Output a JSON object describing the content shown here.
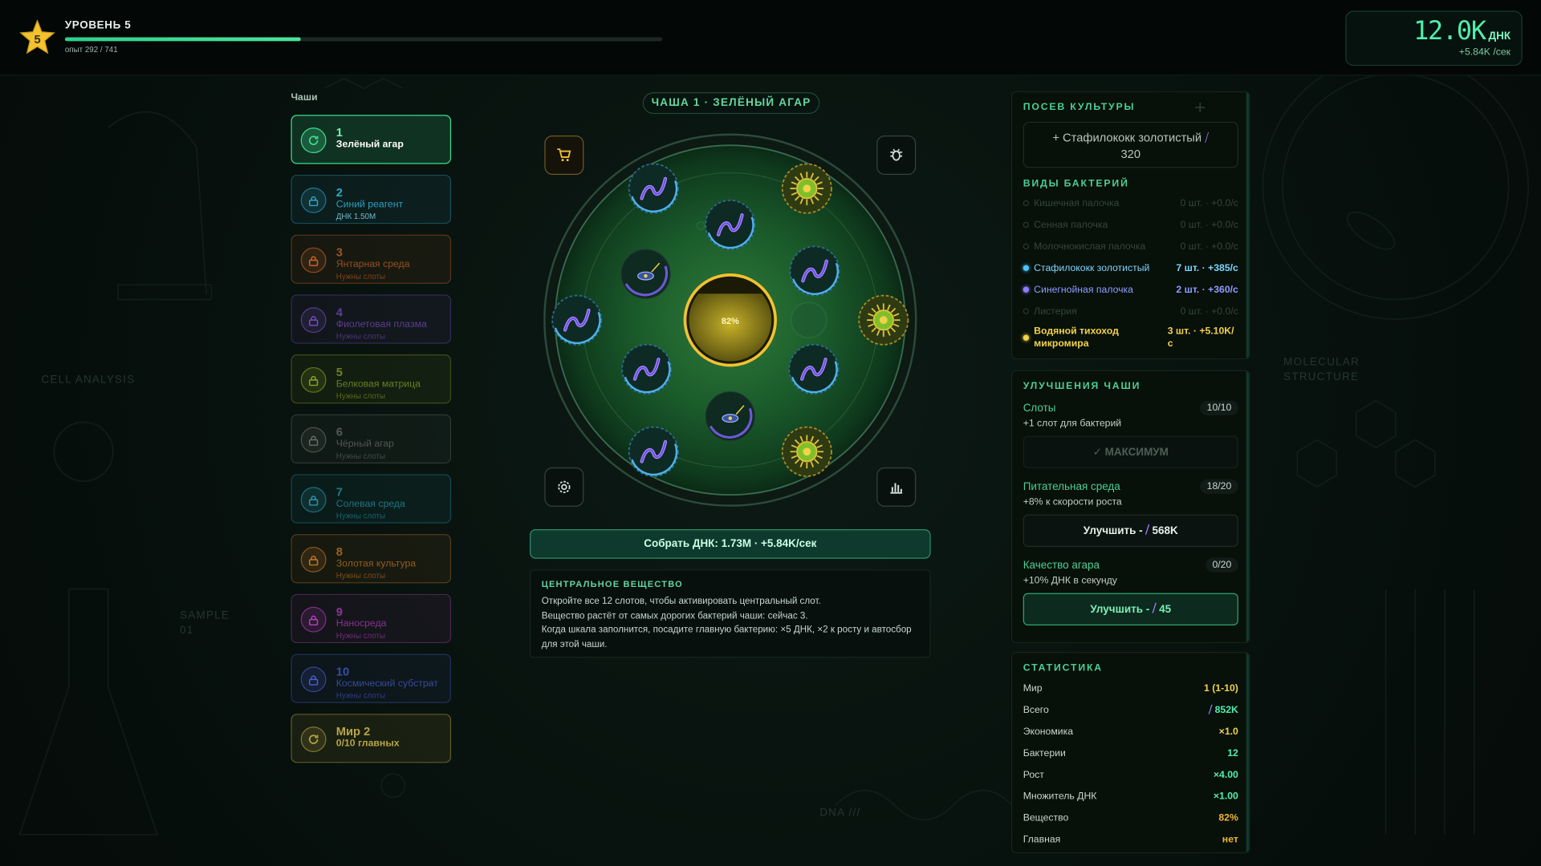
{
  "header": {
    "level_title": "УРОВЕНЬ 5",
    "level_number": "5",
    "xp_text": "опыт 292 / 741",
    "xp_progress": 0.394
  },
  "currency": {
    "value": "12.0K",
    "unit": "ДНК",
    "rate": "+5.84K /сек"
  },
  "sidebar": {
    "title": "Чаши",
    "dishes": [
      {
        "num": "1",
        "name": "Зелёный агар",
        "sub": "",
        "state": "active",
        "color": "#3ddc8f"
      },
      {
        "num": "2",
        "name": "Синий реагент",
        "sub": "ДНК 1.50M",
        "state": "unlockable",
        "color": "#2fa6c8"
      },
      {
        "num": "3",
        "name": "Янтарная среда",
        "sub": "Нужны слоты",
        "state": "locked",
        "color": "#c9662c"
      },
      {
        "num": "4",
        "name": "Фиолетовая плазма",
        "sub": "Нужны слоты",
        "state": "locked",
        "color": "#7a4ec0"
      },
      {
        "num": "5",
        "name": "Белковая матрица",
        "sub": "Нужны слоты",
        "state": "locked",
        "color": "#8aa62a"
      },
      {
        "num": "6",
        "name": "Чёрный агар",
        "sub": "Нужны слоты",
        "state": "locked",
        "color": "#6a6f6d"
      },
      {
        "num": "7",
        "name": "Солевая среда",
        "sub": "Нужны слоты",
        "state": "locked",
        "color": "#2b97ad"
      },
      {
        "num": "8",
        "name": "Золотая культура",
        "sub": "Нужны слоты",
        "state": "locked",
        "color": "#c7782a"
      },
      {
        "num": "9",
        "name": "Наносреда",
        "sub": "Нужны слоты",
        "state": "locked",
        "color": "#b53fbf"
      },
      {
        "num": "10",
        "name": "Космический субстрат",
        "sub": "Нужны слоты",
        "state": "locked",
        "color": "#4a5fd0"
      }
    ],
    "world_card": {
      "title": "Мир 2",
      "sub": "0/10 главных",
      "color": "#b8a445"
    }
  },
  "center": {
    "dish_title": "ЧАША 1 · ЗЕЛЁНЫЙ АГАР",
    "central_percent": "82%",
    "central_fill": 0.82,
    "collect_label": "Собрать ДНК: 1.73M · +5.84K/сек",
    "info_title": "ЦЕНТРАЛЬНОЕ ВЕЩЕСТВО",
    "info_lines": [
      "Откройте все 12 слотов, чтобы активировать центральный слот.",
      "Вещество растёт от самых дорогих бактерий чаши: сейчас 3.",
      "Когда шкала заполнится, посадите главную бактерию: ×5 ДНК, ×2 к росту и автосбор",
      "для этой чаши."
    ]
  },
  "sowing": {
    "title": "ПОСЕВ КУЛЬТУРЫ",
    "item": "+ Стафилококк золотистый",
    "cost": "320"
  },
  "species": {
    "title": "ВИДЫ БАКТЕРИЙ",
    "items": [
      {
        "name": "Кишечная палочка",
        "value": "0 шт. · +0.0/с",
        "active": false,
        "color": "#2a3a33"
      },
      {
        "name": "Сенная палочка",
        "value": "0 шт. · +0.0/с",
        "active": false,
        "color": "#2a3a33"
      },
      {
        "name": "Молочнокислая палочка",
        "value": "0 шт. · +0.0/с",
        "active": false,
        "color": "#2a3a33"
      },
      {
        "name": "Стафилококк золотистый",
        "value": "7 шт. · +385/с",
        "active": true,
        "color": "#4fc3f7"
      },
      {
        "name": "Синегнойная палочка",
        "value": "2 шт. · +360/с",
        "active": true,
        "color": "#8f7cff"
      },
      {
        "name": "Листерия",
        "value": "0 шт. · +0.0/с",
        "active": false,
        "color": "#2a3a33"
      },
      {
        "name": "Водяной тихоход микромира",
        "value": "3 шт. · +5.10K/с",
        "active": true,
        "color": "#f2d24a"
      }
    ]
  },
  "upgrades": {
    "title": "УЛУЧШЕНИЯ ЧАШИ",
    "items": [
      {
        "name": "Слоты",
        "badge": "10/10",
        "desc": "+1 слот для бактерий",
        "button": "✓ МАКСИМУМ",
        "state": "max"
      },
      {
        "name": "Питательная среда",
        "badge": "18/20",
        "desc": "+8% к скорости роста",
        "button": "Улучшить -",
        "cost": "568K",
        "state": "normal"
      },
      {
        "name": "Качество агара",
        "badge": "0/20",
        "desc": "+10% ДНК в секунду",
        "button": "Улучшить -",
        "cost": "45",
        "state": "affordable"
      }
    ]
  },
  "stats": {
    "title": "СТАТИСТИКА",
    "rows": [
      {
        "label": "Мир",
        "value": "1 (1-10)",
        "color": "#f0d24a"
      },
      {
        "label": "Всего",
        "value": "852K",
        "color": "#4ff0ae",
        "icon": true
      },
      {
        "label": "Экономика",
        "value": "×1.0",
        "color": "#f0d24a"
      },
      {
        "label": "Бактерии",
        "value": "12",
        "color": "#4ff0ae"
      },
      {
        "label": "Рост",
        "value": "×4.00",
        "color": "#4ff0ae"
      },
      {
        "label": "Множитель ДНК",
        "value": "×1.00",
        "color": "#4ff0ae"
      },
      {
        "label": "Вещество",
        "value": "82%",
        "color": "#f0b43a"
      },
      {
        "label": "Главная",
        "value": "нет",
        "color": "#f0b43a"
      }
    ]
  },
  "background_labels": {
    "cell": "CELL ANALYSIS",
    "molecular": "MOLECULAR STRUCTURE",
    "sample": "SAMPLE 01",
    "dna": "DNA ///"
  },
  "icons": {
    "star": "star-icon",
    "cart": "cart-icon",
    "bug": "bug-icon",
    "gear": "gear-icon",
    "chart": "chart-icon",
    "lock": "lock-icon",
    "dna": "dna-icon",
    "refresh": "refresh-icon"
  }
}
